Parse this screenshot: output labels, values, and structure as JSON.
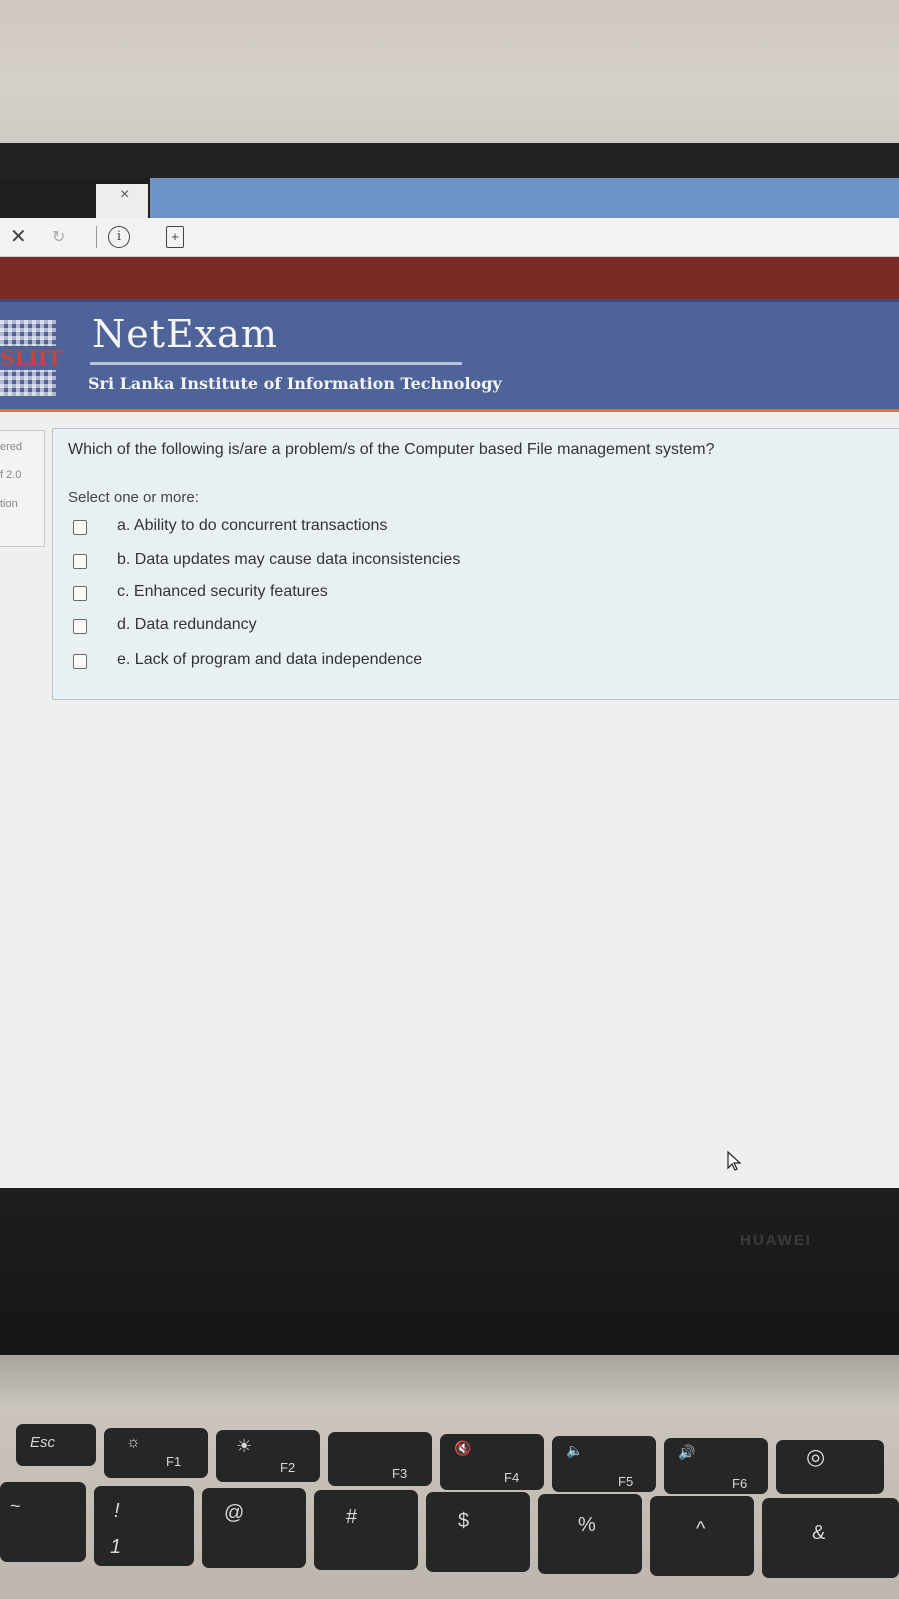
{
  "browser": {
    "tab_close_glyph": "×",
    "stop_glyph": "✕",
    "reload_glyph": "↻",
    "info_glyph": "i",
    "page_glyph": "+"
  },
  "header": {
    "logo_text": "SLIIT",
    "brand": "NetExam",
    "subtitle": "Sri Lanka Institute of Information Technology"
  },
  "sidebar": {
    "line1": "ered",
    "line2": "f 2.0",
    "line3": "tion"
  },
  "question": {
    "text": "Which of the following is/are a problem/s of the Computer based File management system?",
    "select_hint": "Select one or more:",
    "options": [
      {
        "label": "a. Ability to do concurrent transactions",
        "checked": false
      },
      {
        "label": "b. Data updates may cause data inconsistencies",
        "checked": false
      },
      {
        "label": "c. Enhanced security features",
        "checked": false
      },
      {
        "label": "d. Data redundancy",
        "checked": false
      },
      {
        "label": "e. Lack of program and data independence",
        "checked": false
      }
    ]
  },
  "bezel": {
    "brand": "HUAWEI"
  },
  "keyboard": {
    "esc": "Esc",
    "f1": "F1",
    "f2": "F2",
    "f3": "F3",
    "f4": "F4",
    "f5": "F5",
    "f6": "F6",
    "sym_brightness_down": "☼",
    "sym_brightness_up": "☀",
    "sym_mute": "🔇",
    "sym_vol_down": "🔈",
    "sym_vol_up": "🔊",
    "sym_cam": "◎",
    "tilde": "~",
    "excl": "!",
    "one": "1",
    "at": "@",
    "hash": "#",
    "dollar": "$",
    "percent": "%",
    "caret": "^",
    "amp": "&"
  }
}
